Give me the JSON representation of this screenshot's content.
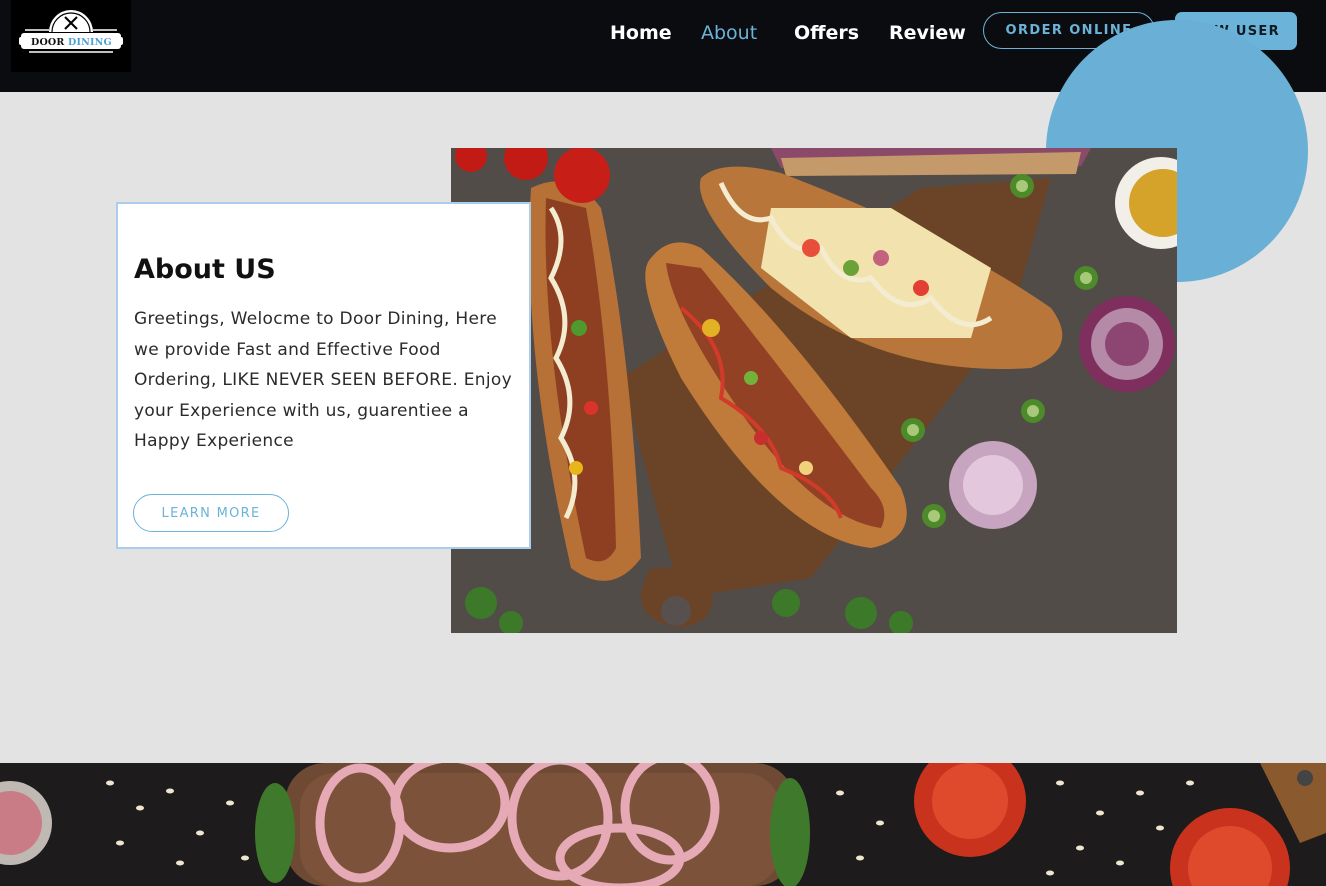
{
  "brand": {
    "name_part1": "DOOR",
    "name_part2": "DINING"
  },
  "nav": {
    "links": [
      {
        "label": "Home",
        "active": false
      },
      {
        "label": "About",
        "active": true
      },
      {
        "label": "Offers",
        "active": false
      },
      {
        "label": "Review",
        "active": false
      }
    ],
    "order_online": "ORDER ONLINE",
    "new_user": "NEW USER"
  },
  "about": {
    "title": "About US",
    "text": "Greetings, Welocme to Door Dining, Here we provide Fast and Effective Food Ordering, LIKE NEVER SEEN BEFORE. Enjoy your Experience with us, guarentiee a Happy Experience",
    "button": "LEARN MORE"
  },
  "colors": {
    "accent": "#6bb3d8",
    "navbar_bg": "#0a0c10",
    "page_bg": "#e3e3e3",
    "card_border": "#a9cdea"
  },
  "icons": [
    "fork-knife-icon"
  ]
}
